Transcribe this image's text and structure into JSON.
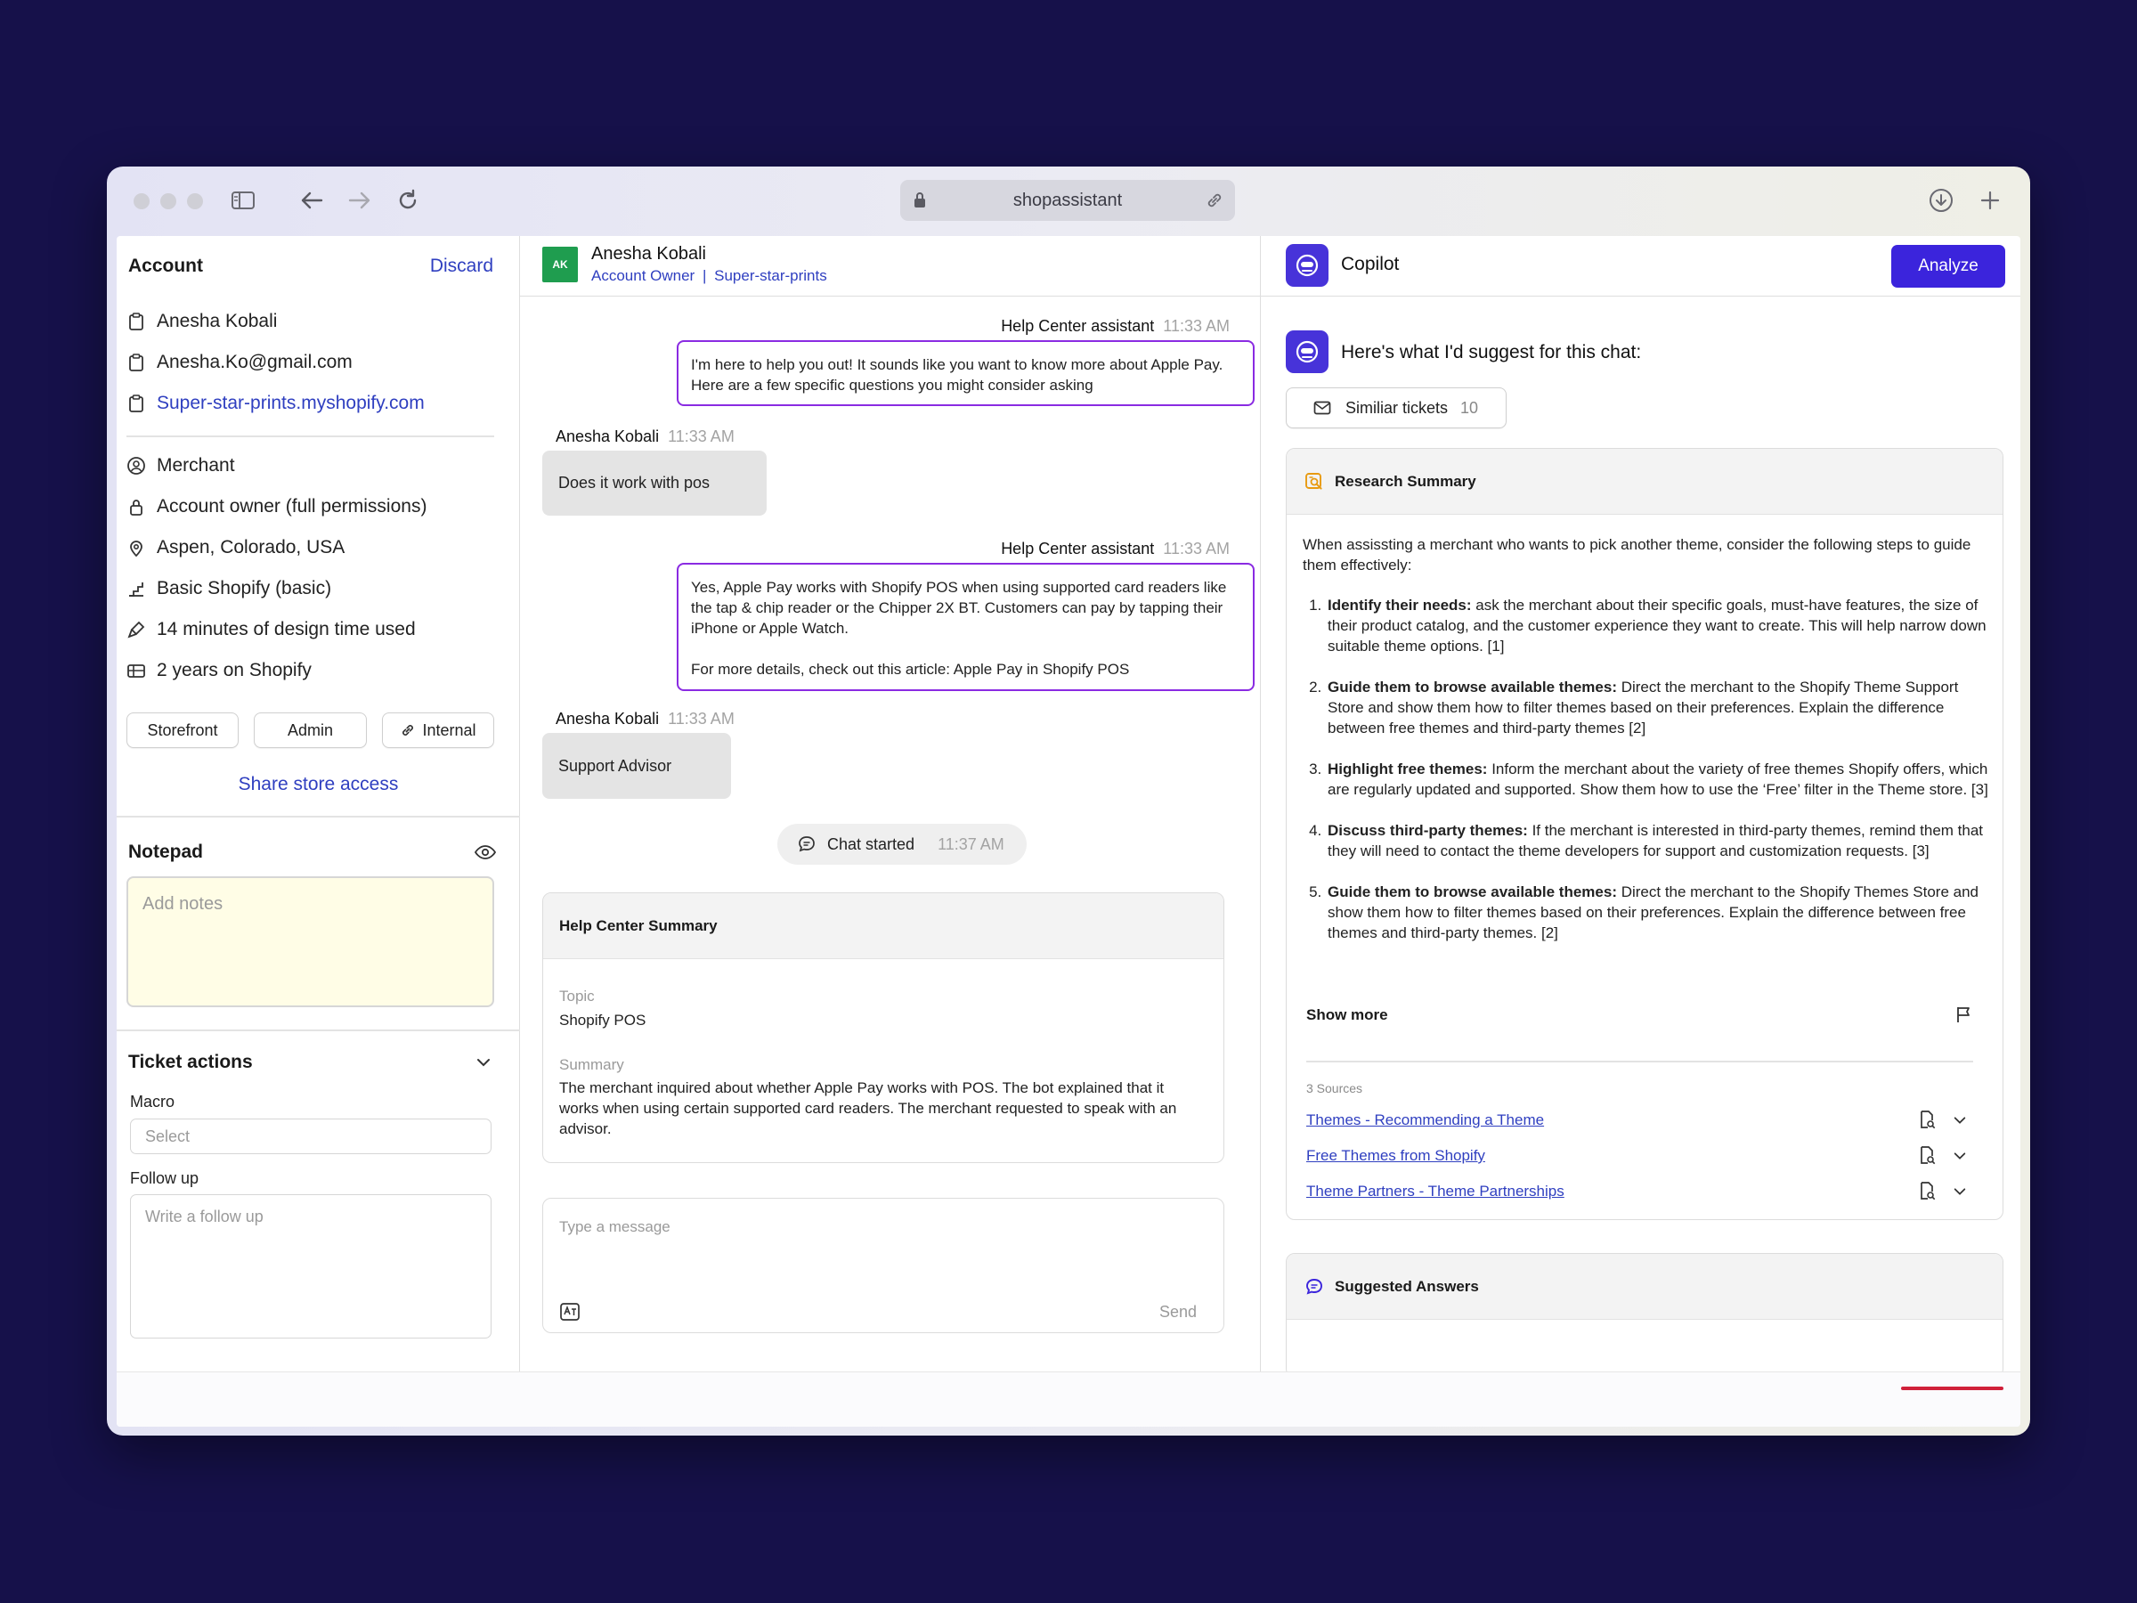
{
  "browser": {
    "url": "shopassistant"
  },
  "account": {
    "title": "Account",
    "discard": "Discard",
    "name": "Anesha Kobali",
    "email": "Anesha.Ko@gmail.com",
    "store": "Super-star-prints.myshopify.com",
    "details": [
      "Merchant",
      "Account owner (full permissions)",
      "Aspen, Colorado, USA",
      "Basic Shopify (basic)",
      "14 minutes of design time used",
      "2 years on Shopify"
    ],
    "buttons": {
      "storefront": "Storefront",
      "admin": "Admin",
      "internal": "Internal"
    },
    "share": "Share store access"
  },
  "notepad": {
    "title": "Notepad",
    "placeholder": "Add notes"
  },
  "ticket": {
    "title": "Ticket actions",
    "macro_label": "Macro",
    "macro_placeholder": "Select",
    "followup_label": "Follow up",
    "followup_placeholder": "Write a follow up"
  },
  "chat": {
    "contact": {
      "initials": "AK",
      "name": "Anesha Kobali",
      "role": "Account Owner",
      "store": "Super-star-prints"
    },
    "messages": [
      {
        "sender": "Help Center assistant",
        "time": "11:33 AM",
        "text": "I'm here to help you out! It sounds like you want to know more about Apple Pay. Here are a few specific questions you might consider asking"
      },
      {
        "sender": "Anesha Kobali",
        "time": "11:33 AM",
        "text": "Does it work with pos"
      },
      {
        "sender": "Help Center assistant",
        "time": "11:33 AM",
        "text": "Yes, Apple Pay works with Shopify POS when using supported card readers like the tap & chip reader or the Chipper 2X BT. Customers can pay by tapping their iPhone or Apple Watch.",
        "text2": "For more details, check out this article: Apple Pay in Shopify POS"
      },
      {
        "sender": "Anesha Kobali",
        "time": "11:33 AM",
        "text": "Support Advisor"
      }
    ],
    "started": {
      "label": "Chat started",
      "time": "11:37 AM"
    },
    "summary": {
      "title": "Help Center Summary",
      "topic_label": "Topic",
      "topic": "Shopify POS",
      "summary_label": "Summary",
      "summary": "The merchant inquired about whether Apple Pay works with POS. The bot explained that it works when using certain supported card readers. The merchant requested to speak with an advisor."
    },
    "composer": {
      "placeholder": "Type a message",
      "send": "Send"
    }
  },
  "copilot": {
    "title": "Copilot",
    "analyze": "Analyze",
    "intro": "Here's what I'd suggest for this chat:",
    "similar": {
      "label": "Similiar tickets",
      "count": "10"
    },
    "research": {
      "title": "Research Summary",
      "intro": "When assissting a merchant who wants to pick another theme, consider the following steps to guide them effectively:",
      "steps": [
        {
          "bold": "Identify their needs:",
          "text": " ask the merchant about their specific goals, must-have features, the size of their product catalog, and the customer experience they want to create. This will help narrow down suitable theme options. [1]"
        },
        {
          "bold": "Guide them to browse available themes:",
          "text": " Direct the merchant to the Shopify Theme Support Store and show them how to filter themes based on their preferences. Explain the difference between free themes and third-party themes [2]"
        },
        {
          "bold": "Highlight free themes:",
          "text": " Inform the merchant about the variety of free themes Shopify offers, which are regularly updated and supported. Show them how to use the ‘Free’ filter in the Theme store. [3]"
        },
        {
          "bold": "Discuss third-party themes:",
          "text": " If the merchant is interested in third-party themes, remind them that they will need to contact the theme developers for support and customization requests. [3]"
        },
        {
          "bold": "Guide them to browse available themes:",
          "text": " Direct the merchant to the Shopify Themes Store and show them how to filter themes based on their preferences. Explain the difference between free themes and third-party themes. [2]"
        }
      ],
      "show_more": "Show more",
      "sources_label": "3 Sources",
      "sources": [
        "Themes - Recommending a Theme",
        "Free Themes from Shopify",
        "Theme Partners - Theme Partnerships"
      ]
    },
    "suggested": {
      "title": "Suggested Answers"
    }
  },
  "colors": {
    "background": "#16114a",
    "accent": "#3b24dc",
    "link": "#2f3fc0",
    "bot_border": "#8a2be2",
    "avatar": "#1f9d4f",
    "notes_bg": "#fffde6"
  }
}
